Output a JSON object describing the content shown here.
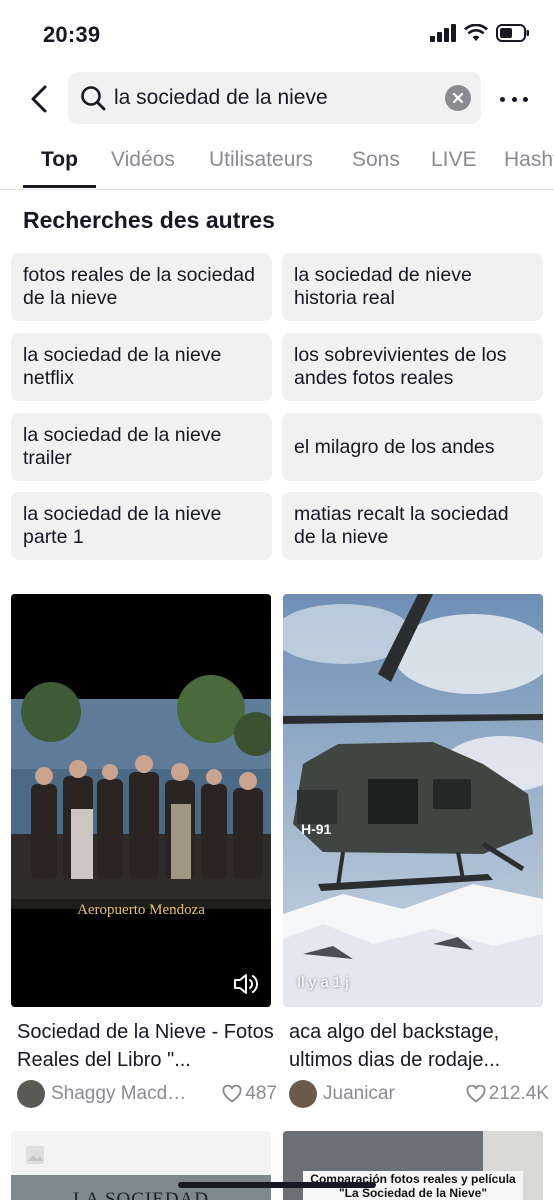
{
  "status": {
    "time": "20:39"
  },
  "search": {
    "query": "la sociedad de la nieve"
  },
  "tabs": [
    {
      "label": "Top"
    },
    {
      "label": "Vidéos"
    },
    {
      "label": "Utilisateurs"
    },
    {
      "label": "Sons"
    },
    {
      "label": "LIVE"
    },
    {
      "label": "Hashtags"
    }
  ],
  "suggestions": {
    "title": "Recherches des autres",
    "items": [
      {
        "label": "fotos reales de la sociedad de la nieve"
      },
      {
        "label": "la sociedad de nieve historia real"
      },
      {
        "label": "la sociedad de la nieve netflix"
      },
      {
        "label": "los sobrevivientes de los andes fotos reales"
      },
      {
        "label": "la sociedad de la nieve trailer"
      },
      {
        "label": "el milagro de los andes"
      },
      {
        "label": "la sociedad de la nieve parte 1"
      },
      {
        "label": "matias recalt la sociedad de la nieve"
      }
    ]
  },
  "videos": [
    {
      "overlay_caption": "Aeropuerto Mendoza",
      "title": "Sociedad de la Nieve - Fotos Reales del Libro \"...",
      "author": "Shaggy Macdo...",
      "likes": "487",
      "icon": "volume-icon"
    },
    {
      "badge": "Il y a 1 j",
      "tail_marking": "H-91",
      "title": "aca algo del backstage, ultimos dias de rodaje...",
      "author": "Juanicar",
      "likes": "212.4K"
    },
    {
      "overlay_caption": "LA SOCIEDAD"
    },
    {
      "overlay_caption": "Comparación fotos reales y película \"La Sociedad de la Nieve\""
    }
  ],
  "colors": {
    "text": "#161823",
    "muted": "#8a8b91",
    "chip_bg": "#f1f1f2"
  }
}
